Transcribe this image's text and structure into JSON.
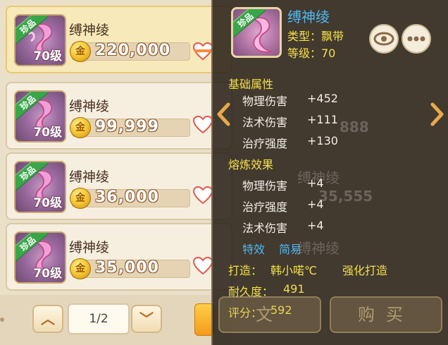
{
  "list": {
    "items": [
      {
        "name": "缚神绫",
        "badge": "珍品",
        "level": "70级",
        "price": "220,000",
        "selected": true
      },
      {
        "name": "缚神绫",
        "badge": "珍品",
        "level": "70级",
        "price": "99,999",
        "selected": false
      },
      {
        "name": "缚神绫",
        "badge": "珍品",
        "level": "70级",
        "price": "36,000",
        "selected": false
      },
      {
        "name": "缚神绫",
        "badge": "珍品",
        "level": "70级",
        "price": "35,000",
        "selected": false
      }
    ],
    "coin_glyph": "金"
  },
  "pager": {
    "page": "1/2",
    "up": "︿",
    "down": "﹀"
  },
  "tooltip": {
    "badge": "珍品",
    "name": "缚神绫",
    "type_line": "类型：飘带",
    "level_line": "等级：70",
    "base_title": "基础属性",
    "base_attrs": [
      {
        "label": "物理伤害",
        "value": "+452"
      },
      {
        "label": "法术伤害",
        "value": "+111"
      },
      {
        "label": "治疗强度",
        "value": "+130"
      }
    ],
    "refine_title": "熔炼效果",
    "refine_attrs": [
      {
        "label": "物理伤害",
        "value": "+4"
      },
      {
        "label": "治疗强度",
        "value": "+4"
      },
      {
        "label": "法术伤害",
        "value": "+4"
      }
    ],
    "effect_label": "特效",
    "effect_value": "简易",
    "forge_label": "打造：",
    "forger": "韩小喏℃",
    "forge_type": "强化打造",
    "durability_label": "耐久度：",
    "durability": "491",
    "score_label": "评分：",
    "score": "592"
  },
  "buttons": {
    "left": "文",
    "buy": "购买"
  },
  "background_ghosts": [
    "888",
    "缚神绫",
    "35,555",
    "缚神绫"
  ],
  "colors": {
    "title_blue": "#4fb8f0",
    "label_yellow": "#f3e04a",
    "badge_green": "#3aa64a"
  }
}
